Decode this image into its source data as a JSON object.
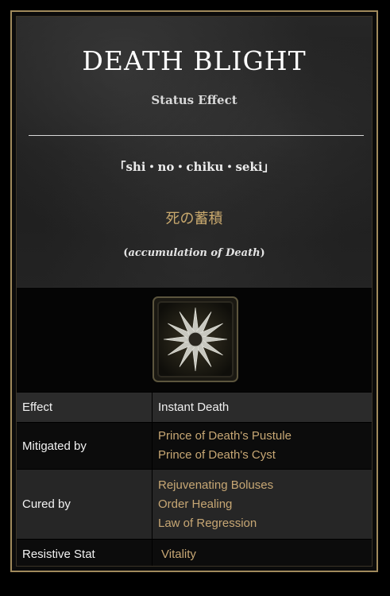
{
  "header": {
    "title": "DEATH BLIGHT",
    "subtitle": "Status Effect",
    "romaji": "「shi・no・chiku・seki」",
    "kanji": "死の蓄積",
    "meaning_open": "(",
    "meaning_text": "accumulation of Death",
    "meaning_close": ")"
  },
  "icon": {
    "name": "death-blight-icon"
  },
  "table": {
    "effect": {
      "label": "Effect",
      "value": "Instant Death"
    },
    "mitigated": {
      "label": "Mitigated by",
      "items": [
        "Prince of Death's Pustule",
        "Prince of Death's Cyst"
      ]
    },
    "cured": {
      "label": "Cured by",
      "items": [
        "Rejuvenating Boluses",
        "Order Healing",
        "Law of Regression"
      ]
    },
    "resistive": {
      "label": "Resistive Stat",
      "value": "Vitality"
    }
  },
  "colors": {
    "border": "#a08a5c",
    "gold_text": "#c7a774",
    "kanji": "#c9a96e"
  }
}
